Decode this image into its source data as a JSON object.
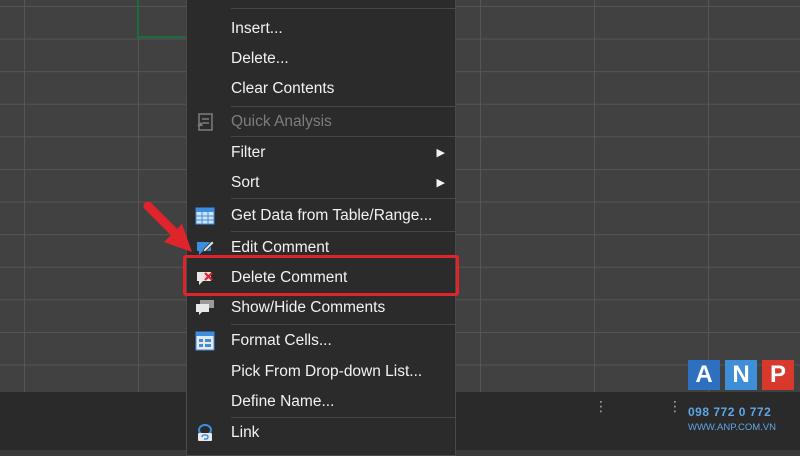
{
  "context_menu": {
    "items": [
      {
        "label": "Insert...",
        "enabled": true
      },
      {
        "label": "Delete...",
        "enabled": true
      },
      {
        "label": "Clear Contents",
        "enabled": true
      },
      {
        "label": "Quick Analysis",
        "enabled": false,
        "icon": "quick-analysis-icon"
      },
      {
        "label": "Filter",
        "enabled": true,
        "has_submenu": true
      },
      {
        "label": "Sort",
        "enabled": true,
        "has_submenu": true
      },
      {
        "label": "Get Data from Table/Range...",
        "enabled": true,
        "icon": "table-icon"
      },
      {
        "label": "Edit Comment",
        "enabled": true,
        "icon": "edit-comment-icon"
      },
      {
        "label": "Delete Comment",
        "enabled": true,
        "icon": "delete-comment-icon",
        "highlighted": true
      },
      {
        "label": "Show/Hide Comments",
        "enabled": true,
        "icon": "show-hide-comments-icon"
      },
      {
        "label": "Format Cells...",
        "enabled": true,
        "icon": "format-cells-icon"
      },
      {
        "label": "Pick From Drop-down List...",
        "enabled": true
      },
      {
        "label": "Define Name...",
        "enabled": true
      },
      {
        "label": "Link",
        "enabled": true,
        "icon": "link-icon"
      }
    ],
    "submenu_glyph": "▶"
  },
  "annotation": {
    "highlight_color": "#e0242b"
  },
  "status_bar": {
    "dots": "⋮"
  },
  "watermark": {
    "letters": [
      "A",
      "N",
      "P"
    ],
    "tile_colors": [
      "#2e6fc0",
      "#3f8fd8",
      "#d9382c"
    ],
    "phone": "098 772 0 772",
    "website": "WWW.ANP.COM.VN"
  },
  "colors": {
    "menu_background": "#2b2b2b",
    "menu_text": "#f2f2f2",
    "disabled_text": "#7d7d7d",
    "grid_background": "#414141"
  }
}
